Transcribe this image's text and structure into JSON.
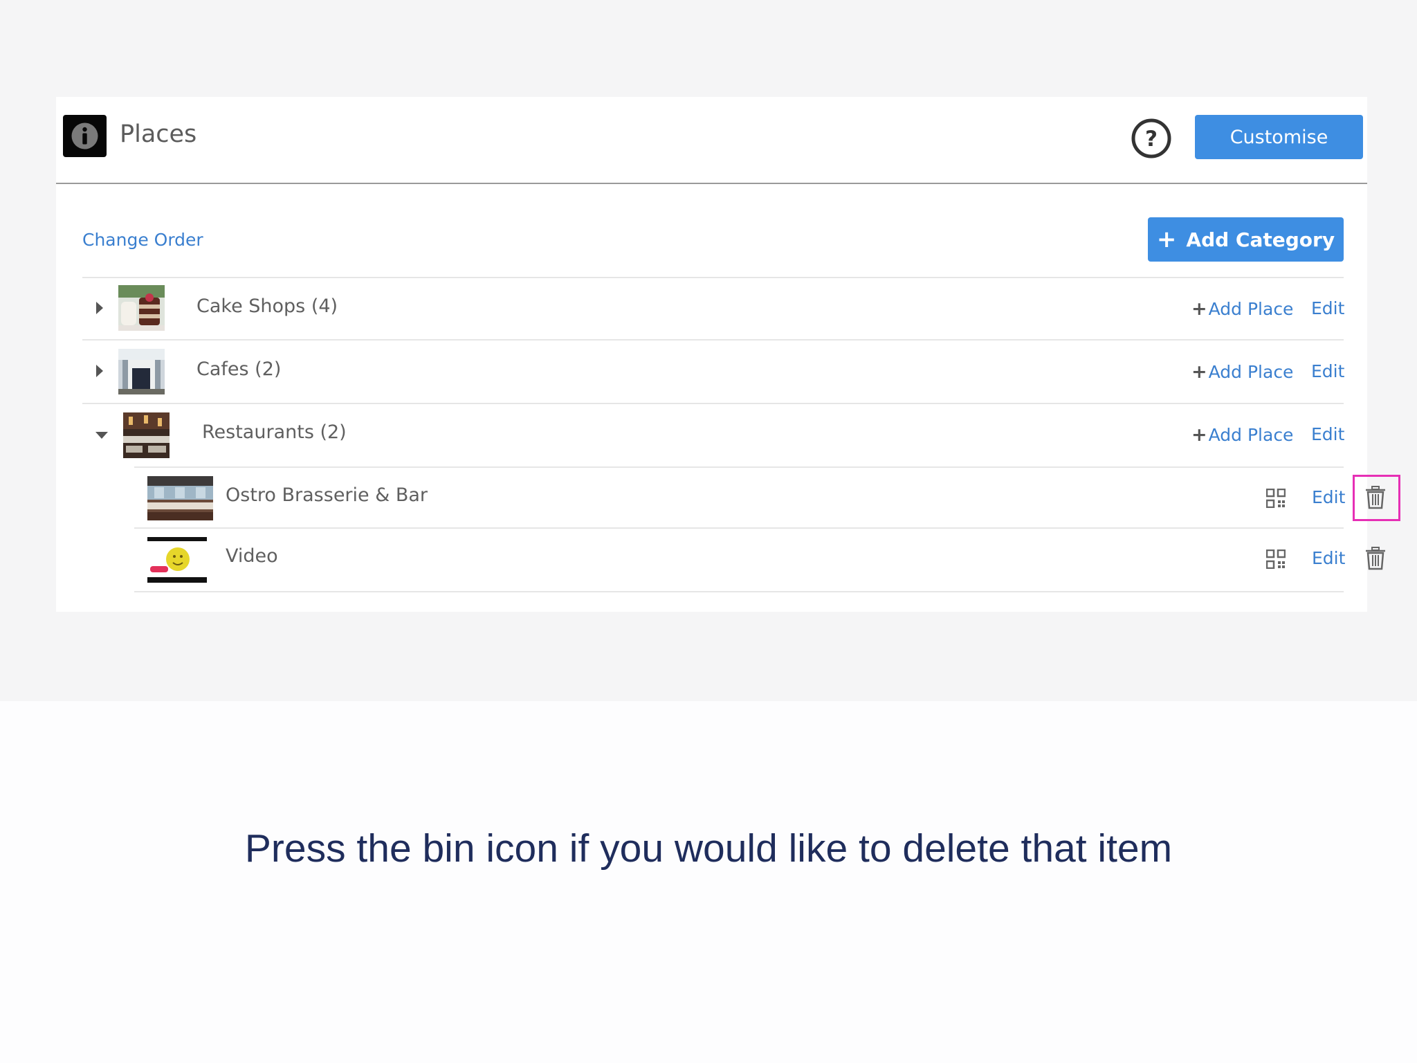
{
  "header": {
    "title": "Places",
    "customise_label": "Customise",
    "help_icon": "question-circle-icon",
    "logo_icon": "info-icon"
  },
  "toolbar": {
    "change_order_label": "Change Order",
    "add_category_label": "Add Category",
    "add_category_icon": "+"
  },
  "categories": [
    {
      "label": "Cake Shops (4)",
      "expanded": false,
      "add_place_label": "Add Place",
      "edit_label": "Edit"
    },
    {
      "label": "Cafes (2)",
      "expanded": false,
      "add_place_label": "Add Place",
      "edit_label": "Edit"
    },
    {
      "label": "Restaurants (2)",
      "expanded": true,
      "add_place_label": "Add Place",
      "edit_label": "Edit",
      "places": [
        {
          "label": "Ostro Brasserie & Bar",
          "edit_label": "Edit",
          "highlighted": true
        },
        {
          "label": "Video",
          "edit_label": "Edit",
          "highlighted": false
        }
      ]
    }
  ],
  "add_place_plus": "+",
  "caption": "Press the bin icon if you would like to delete that item",
  "colors": {
    "accent": "#3e8ee2",
    "link": "#3a7fcf",
    "highlight": "#e62fb5",
    "caption": "#1f2d5c"
  }
}
